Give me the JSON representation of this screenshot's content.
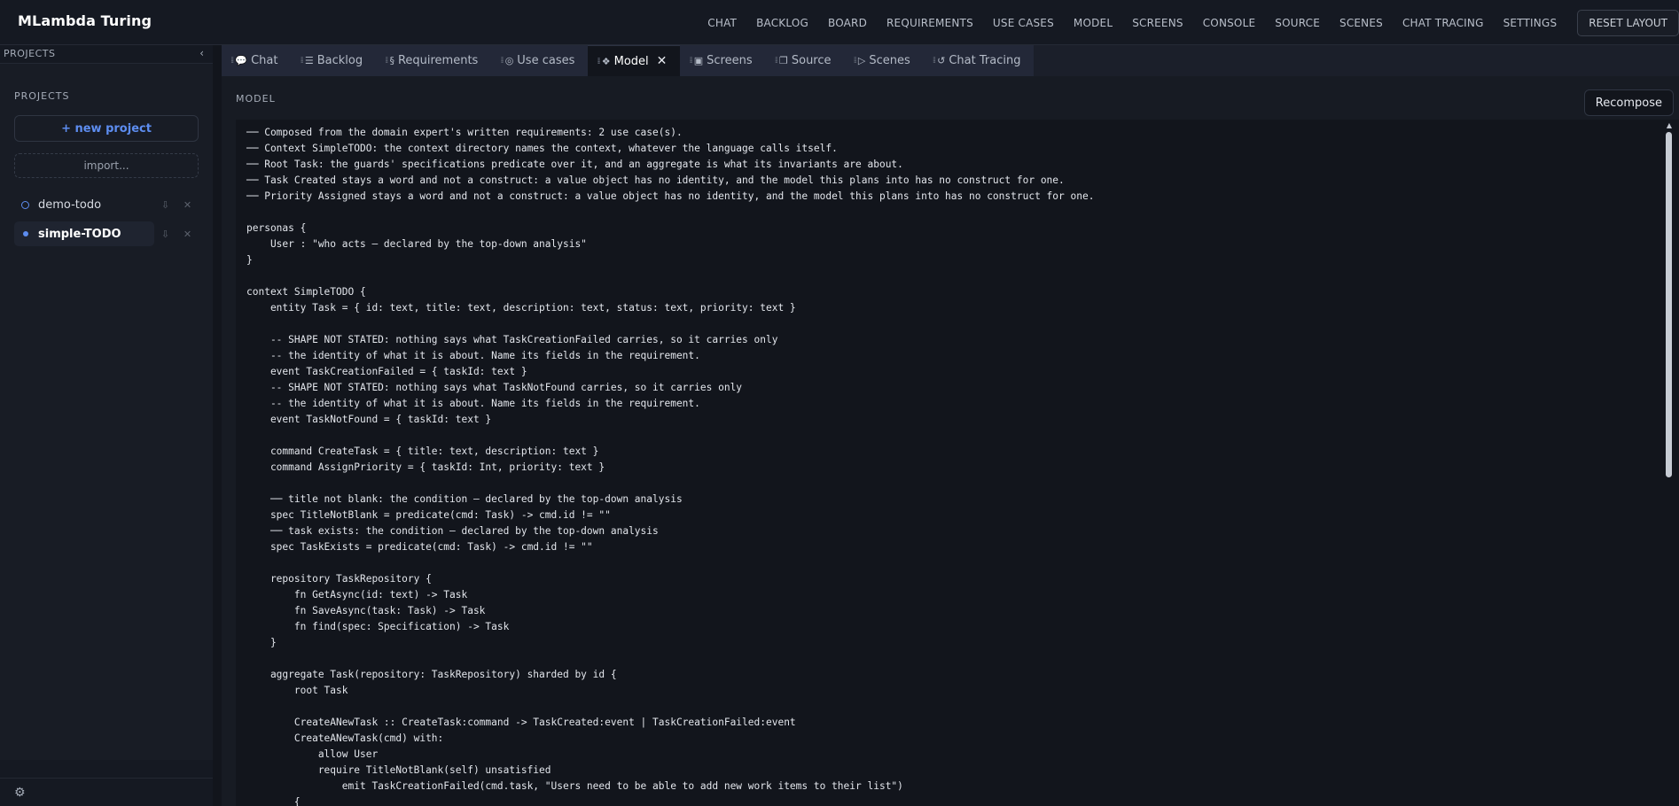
{
  "app": {
    "title": "MLambda Turing"
  },
  "topnav": {
    "items": [
      "CHAT",
      "BACKLOG",
      "BOARD",
      "REQUIREMENTS",
      "USE CASES",
      "MODEL",
      "SCREENS",
      "CONSOLE",
      "SOURCE",
      "SCENES",
      "CHAT TRACING",
      "SETTINGS"
    ],
    "reset_label": "RESET LAYOUT"
  },
  "sidebar": {
    "header": "PROJECTS",
    "collapse_glyph": "‹",
    "panel_title": "PROJECTS",
    "new_project_label": "+ new project",
    "import_label": "import...",
    "projects": [
      {
        "name": "demo-todo",
        "active": false
      },
      {
        "name": "simple-TODO",
        "active": true
      }
    ],
    "pin_glyph": "⇩",
    "remove_glyph": "✕",
    "settings_glyph": "⚙"
  },
  "tabs": [
    {
      "label": "Chat",
      "icon": "💬"
    },
    {
      "label": "Backlog",
      "icon": "☰"
    },
    {
      "label": "Requirements",
      "icon": "§"
    },
    {
      "label": "Use cases",
      "icon": "◎"
    },
    {
      "label": "Model",
      "icon": "❖",
      "active": true
    },
    {
      "label": "Screens",
      "icon": "▣"
    },
    {
      "label": "Source",
      "icon": "❐"
    },
    {
      "label": "Scenes",
      "icon": "▷"
    },
    {
      "label": "Chat Tracing",
      "icon": "↺"
    }
  ],
  "tab_close_glyph": "✕",
  "model": {
    "section_label": "MODEL",
    "recompose_label": "Recompose",
    "code": "── Composed from the domain expert's written requirements: 2 use case(s).\n── Context SimpleTODO: the context directory names the context, whatever the language calls itself.\n── Root Task: the guards' specifications predicate over it, and an aggregate is what its invariants are about.\n── Task Created stays a word and not a construct: a value object has no identity, and the model this plans into has no construct for one.\n── Priority Assigned stays a word and not a construct: a value object has no identity, and the model this plans into has no construct for one.\n\npersonas {\n    User : \"who acts — declared by the top-down analysis\"\n}\n\ncontext SimpleTODO {\n    entity Task = { id: text, title: text, description: text, status: text, priority: text }\n\n    -- SHAPE NOT STATED: nothing says what TaskCreationFailed carries, so it carries only\n    -- the identity of what it is about. Name its fields in the requirement.\n    event TaskCreationFailed = { taskId: text }\n    -- SHAPE NOT STATED: nothing says what TaskNotFound carries, so it carries only\n    -- the identity of what it is about. Name its fields in the requirement.\n    event TaskNotFound = { taskId: text }\n\n    command CreateTask = { title: text, description: text }\n    command AssignPriority = { taskId: Int, priority: text }\n\n    ── title not blank: the condition — declared by the top-down analysis\n    spec TitleNotBlank = predicate(cmd: Task) -> cmd.id != \"\"\n    ── task exists: the condition — declared by the top-down analysis\n    spec TaskExists = predicate(cmd: Task) -> cmd.id != \"\"\n\n    repository TaskRepository {\n        fn GetAsync(id: text) -> Task\n        fn SaveAsync(task: Task) -> Task\n        fn find(spec: Specification) -> Task\n    }\n\n    aggregate Task(repository: TaskRepository) sharded by id {\n        root Task\n\n        CreateANewTask :: CreateTask:command -> TaskCreated:event | TaskCreationFailed:event\n        CreateANewTask(cmd) with:\n            allow User\n            require TitleNotBlank(self) unsatisfied\n                emit TaskCreationFailed(cmd.task, \"Users need to be able to add new work items to their list\")\n        {"
  },
  "scroll_up_glyph": "▲"
}
